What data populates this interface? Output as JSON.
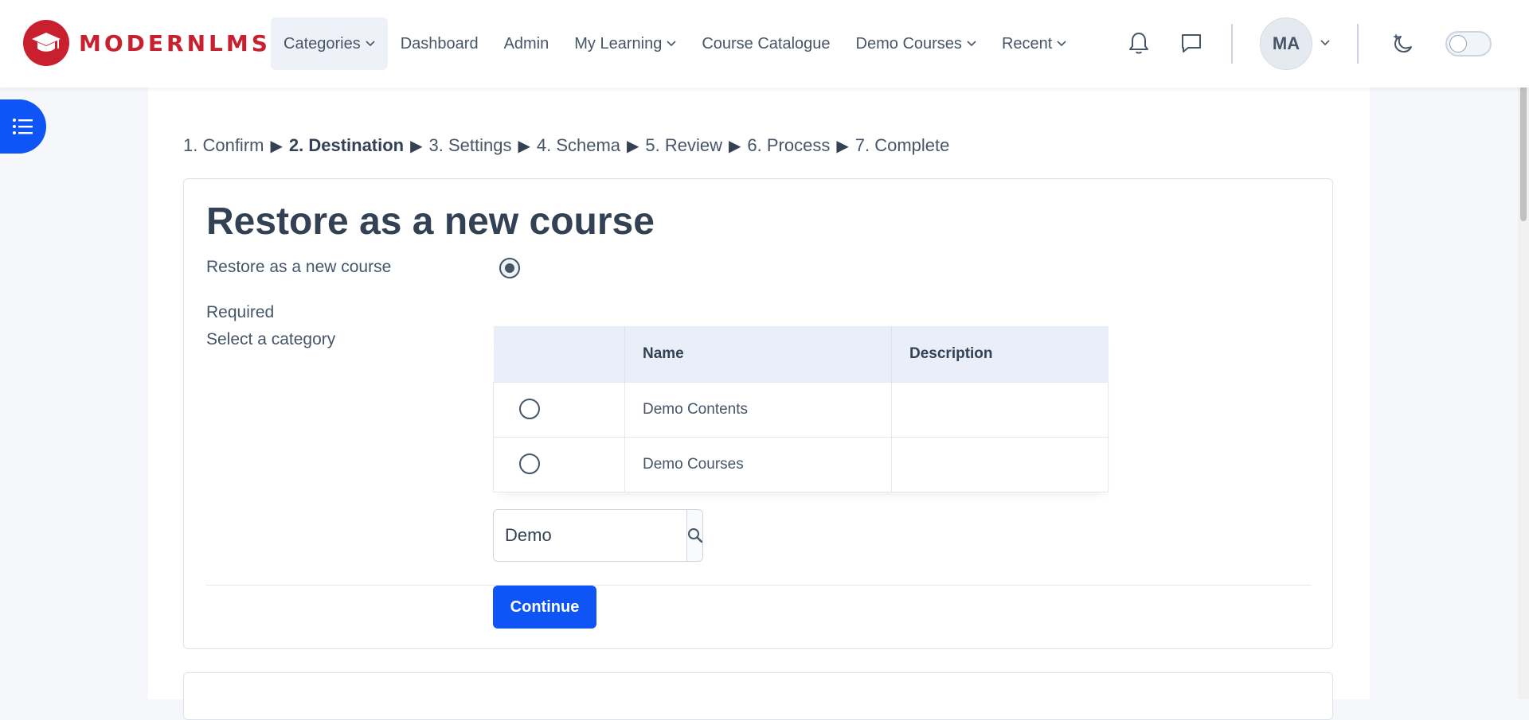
{
  "brand": {
    "name": "MODERNLMS"
  },
  "nav": {
    "items": [
      {
        "label": "Categories",
        "dropdown": true,
        "active": true
      },
      {
        "label": "Dashboard",
        "dropdown": false
      },
      {
        "label": "Admin",
        "dropdown": false
      },
      {
        "label": "My Learning",
        "dropdown": true
      },
      {
        "label": "Course Catalogue",
        "dropdown": false
      },
      {
        "label": "Demo Courses",
        "dropdown": true
      },
      {
        "label": "Recent",
        "dropdown": true
      }
    ],
    "icons": [
      "bell-icon",
      "chat-icon",
      "moon-stars-icon"
    ],
    "user_initials": "MA",
    "dark_mode_on": false
  },
  "steps": [
    {
      "label": "1. Confirm",
      "current": false
    },
    {
      "label": "2. Destination",
      "current": true
    },
    {
      "label": "3. Settings",
      "current": false
    },
    {
      "label": "4. Schema",
      "current": false
    },
    {
      "label": "5. Review",
      "current": false
    },
    {
      "label": "6. Process",
      "current": false
    },
    {
      "label": "7. Complete",
      "current": false
    }
  ],
  "form": {
    "title": "Restore as a new course",
    "restore_option_label": "Restore as a new course",
    "restore_option_selected": true,
    "required_label": "Required",
    "category_label": "Select a category",
    "table": {
      "headers": [
        "",
        "Name",
        "Description"
      ],
      "rows": [
        {
          "name": "Demo Contents",
          "description": "",
          "selected": false
        },
        {
          "name": "Demo Courses",
          "description": "",
          "selected": false
        }
      ]
    },
    "search_value": "Demo",
    "continue_label": "Continue"
  },
  "colors": {
    "brand": "#c8202f",
    "primary": "#0f55f5"
  }
}
